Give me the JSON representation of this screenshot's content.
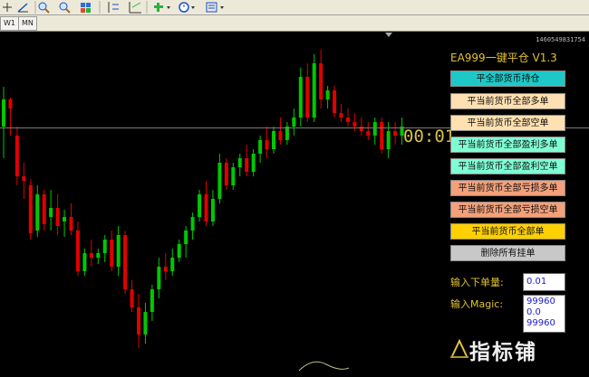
{
  "toolbar": {
    "icons": [
      "crosshair-icon",
      "trendline-icon",
      "zoom-in-icon",
      "zoom-out-icon",
      "tile-windows-icon",
      "period-separator-icon",
      "grid-icon",
      "indicator-add-icon",
      "clock-period-icon",
      "template-icon"
    ]
  },
  "tabs": {
    "items": [
      "W1",
      "MN"
    ]
  },
  "chart": {
    "timestamp": "1460549831754",
    "countdown": "00:01",
    "colors": {
      "bull": "#00c800",
      "bear": "#e00000",
      "grid_line": "#7a7a7a",
      "background": "#000000"
    }
  },
  "chart_data": {
    "type": "candlestick",
    "candles": [
      {
        "o": 140,
        "h": 96,
        "l": 175,
        "c": 110
      },
      {
        "o": 110,
        "h": 108,
        "l": 150,
        "c": 120
      },
      {
        "o": 150,
        "h": 140,
        "l": 205,
        "c": 195
      },
      {
        "o": 195,
        "h": 180,
        "l": 220,
        "c": 200
      },
      {
        "o": 205,
        "h": 198,
        "l": 265,
        "c": 258
      },
      {
        "o": 255,
        "h": 205,
        "l": 262,
        "c": 215
      },
      {
        "o": 215,
        "h": 210,
        "l": 255,
        "c": 248
      },
      {
        "o": 240,
        "h": 210,
        "l": 255,
        "c": 230
      },
      {
        "o": 230,
        "h": 215,
        "l": 260,
        "c": 250
      },
      {
        "o": 245,
        "h": 232,
        "l": 262,
        "c": 240
      },
      {
        "o": 240,
        "h": 225,
        "l": 260,
        "c": 255
      },
      {
        "o": 255,
        "h": 245,
        "l": 305,
        "c": 300
      },
      {
        "o": 300,
        "h": 275,
        "l": 305,
        "c": 280
      },
      {
        "o": 280,
        "h": 265,
        "l": 295,
        "c": 285
      },
      {
        "o": 285,
        "h": 275,
        "l": 292,
        "c": 280
      },
      {
        "o": 280,
        "h": 260,
        "l": 290,
        "c": 265
      },
      {
        "o": 265,
        "h": 255,
        "l": 300,
        "c": 295
      },
      {
        "o": 295,
        "h": 250,
        "l": 305,
        "c": 260
      },
      {
        "o": 260,
        "h": 255,
        "l": 325,
        "c": 320
      },
      {
        "o": 320,
        "h": 310,
        "l": 345,
        "c": 340
      },
      {
        "o": 340,
        "h": 325,
        "l": 385,
        "c": 370
      },
      {
        "o": 370,
        "h": 335,
        "l": 380,
        "c": 345
      },
      {
        "o": 345,
        "h": 315,
        "l": 355,
        "c": 320
      },
      {
        "o": 320,
        "h": 285,
        "l": 330,
        "c": 295
      },
      {
        "o": 295,
        "h": 280,
        "l": 310,
        "c": 300
      },
      {
        "o": 300,
        "h": 275,
        "l": 305,
        "c": 285
      },
      {
        "o": 285,
        "h": 265,
        "l": 290,
        "c": 270
      },
      {
        "o": 270,
        "h": 250,
        "l": 285,
        "c": 255
      },
      {
        "o": 255,
        "h": 235,
        "l": 265,
        "c": 240
      },
      {
        "o": 240,
        "h": 210,
        "l": 245,
        "c": 215
      },
      {
        "o": 215,
        "h": 200,
        "l": 250,
        "c": 245
      },
      {
        "o": 245,
        "h": 210,
        "l": 250,
        "c": 220
      },
      {
        "o": 220,
        "h": 170,
        "l": 225,
        "c": 180
      },
      {
        "o": 180,
        "h": 175,
        "l": 210,
        "c": 205
      },
      {
        "o": 205,
        "h": 180,
        "l": 210,
        "c": 185
      },
      {
        "o": 185,
        "h": 170,
        "l": 195,
        "c": 175
      },
      {
        "o": 175,
        "h": 160,
        "l": 195,
        "c": 190
      },
      {
        "o": 190,
        "h": 165,
        "l": 195,
        "c": 170
      },
      {
        "o": 170,
        "h": 150,
        "l": 180,
        "c": 155
      },
      {
        "o": 155,
        "h": 140,
        "l": 175,
        "c": 165
      },
      {
        "o": 165,
        "h": 140,
        "l": 170,
        "c": 145
      },
      {
        "o": 145,
        "h": 130,
        "l": 160,
        "c": 155
      },
      {
        "o": 155,
        "h": 135,
        "l": 160,
        "c": 140
      },
      {
        "o": 140,
        "h": 120,
        "l": 150,
        "c": 130
      },
      {
        "o": 130,
        "h": 75,
        "l": 140,
        "c": 85
      },
      {
        "o": 85,
        "h": 70,
        "l": 135,
        "c": 130
      },
      {
        "o": 130,
        "h": 60,
        "l": 135,
        "c": 70
      },
      {
        "o": 70,
        "h": 55,
        "l": 120,
        "c": 110
      },
      {
        "o": 110,
        "h": 95,
        "l": 120,
        "c": 100
      },
      {
        "o": 100,
        "h": 95,
        "l": 130,
        "c": 125
      },
      {
        "o": 125,
        "h": 115,
        "l": 135,
        "c": 130
      },
      {
        "o": 130,
        "h": 120,
        "l": 140,
        "c": 135
      },
      {
        "o": 135,
        "h": 125,
        "l": 145,
        "c": 140
      },
      {
        "o": 140,
        "h": 130,
        "l": 150,
        "c": 145
      },
      {
        "o": 145,
        "h": 135,
        "l": 155,
        "c": 150
      },
      {
        "o": 150,
        "h": 130,
        "l": 160,
        "c": 135
      },
      {
        "o": 135,
        "h": 130,
        "l": 170,
        "c": 165
      },
      {
        "o": 165,
        "h": 135,
        "l": 175,
        "c": 145
      },
      {
        "o": 145,
        "h": 135,
        "l": 160,
        "c": 150
      },
      {
        "o": 150,
        "h": 130,
        "l": 160,
        "c": 140
      }
    ]
  },
  "panel": {
    "title": "EA999一键平仓 V1.3",
    "buttons": [
      {
        "label": "平全部货币持仓",
        "bg": "#1ec8c8"
      },
      {
        "label": "平当前货币全部多单",
        "bg": "#ffe0b0"
      },
      {
        "label": "平当前货币全部空单",
        "bg": "#ffe0b0"
      },
      {
        "label": "平当前货币全部盈利多单",
        "bg": "#7fffd4"
      },
      {
        "label": "平当前货币全部盈利空单",
        "bg": "#7fffd4"
      },
      {
        "label": "平当前货币全部亏损多单",
        "bg": "#f4a07a"
      },
      {
        "label": "平当前货币全部亏损空单",
        "bg": "#f4a07a"
      },
      {
        "label": "平当前货币全部单",
        "bg": "#ffd000"
      },
      {
        "label": "删除所有挂单",
        "bg": "#c8c8c8"
      }
    ],
    "lot_label": "输入下单量:",
    "lot_value": "0.01",
    "magic_label": "输入Magic:",
    "magic_lines": [
      "99960",
      "0.0",
      "99960"
    ]
  },
  "watermark": {
    "text": "指标铺"
  }
}
